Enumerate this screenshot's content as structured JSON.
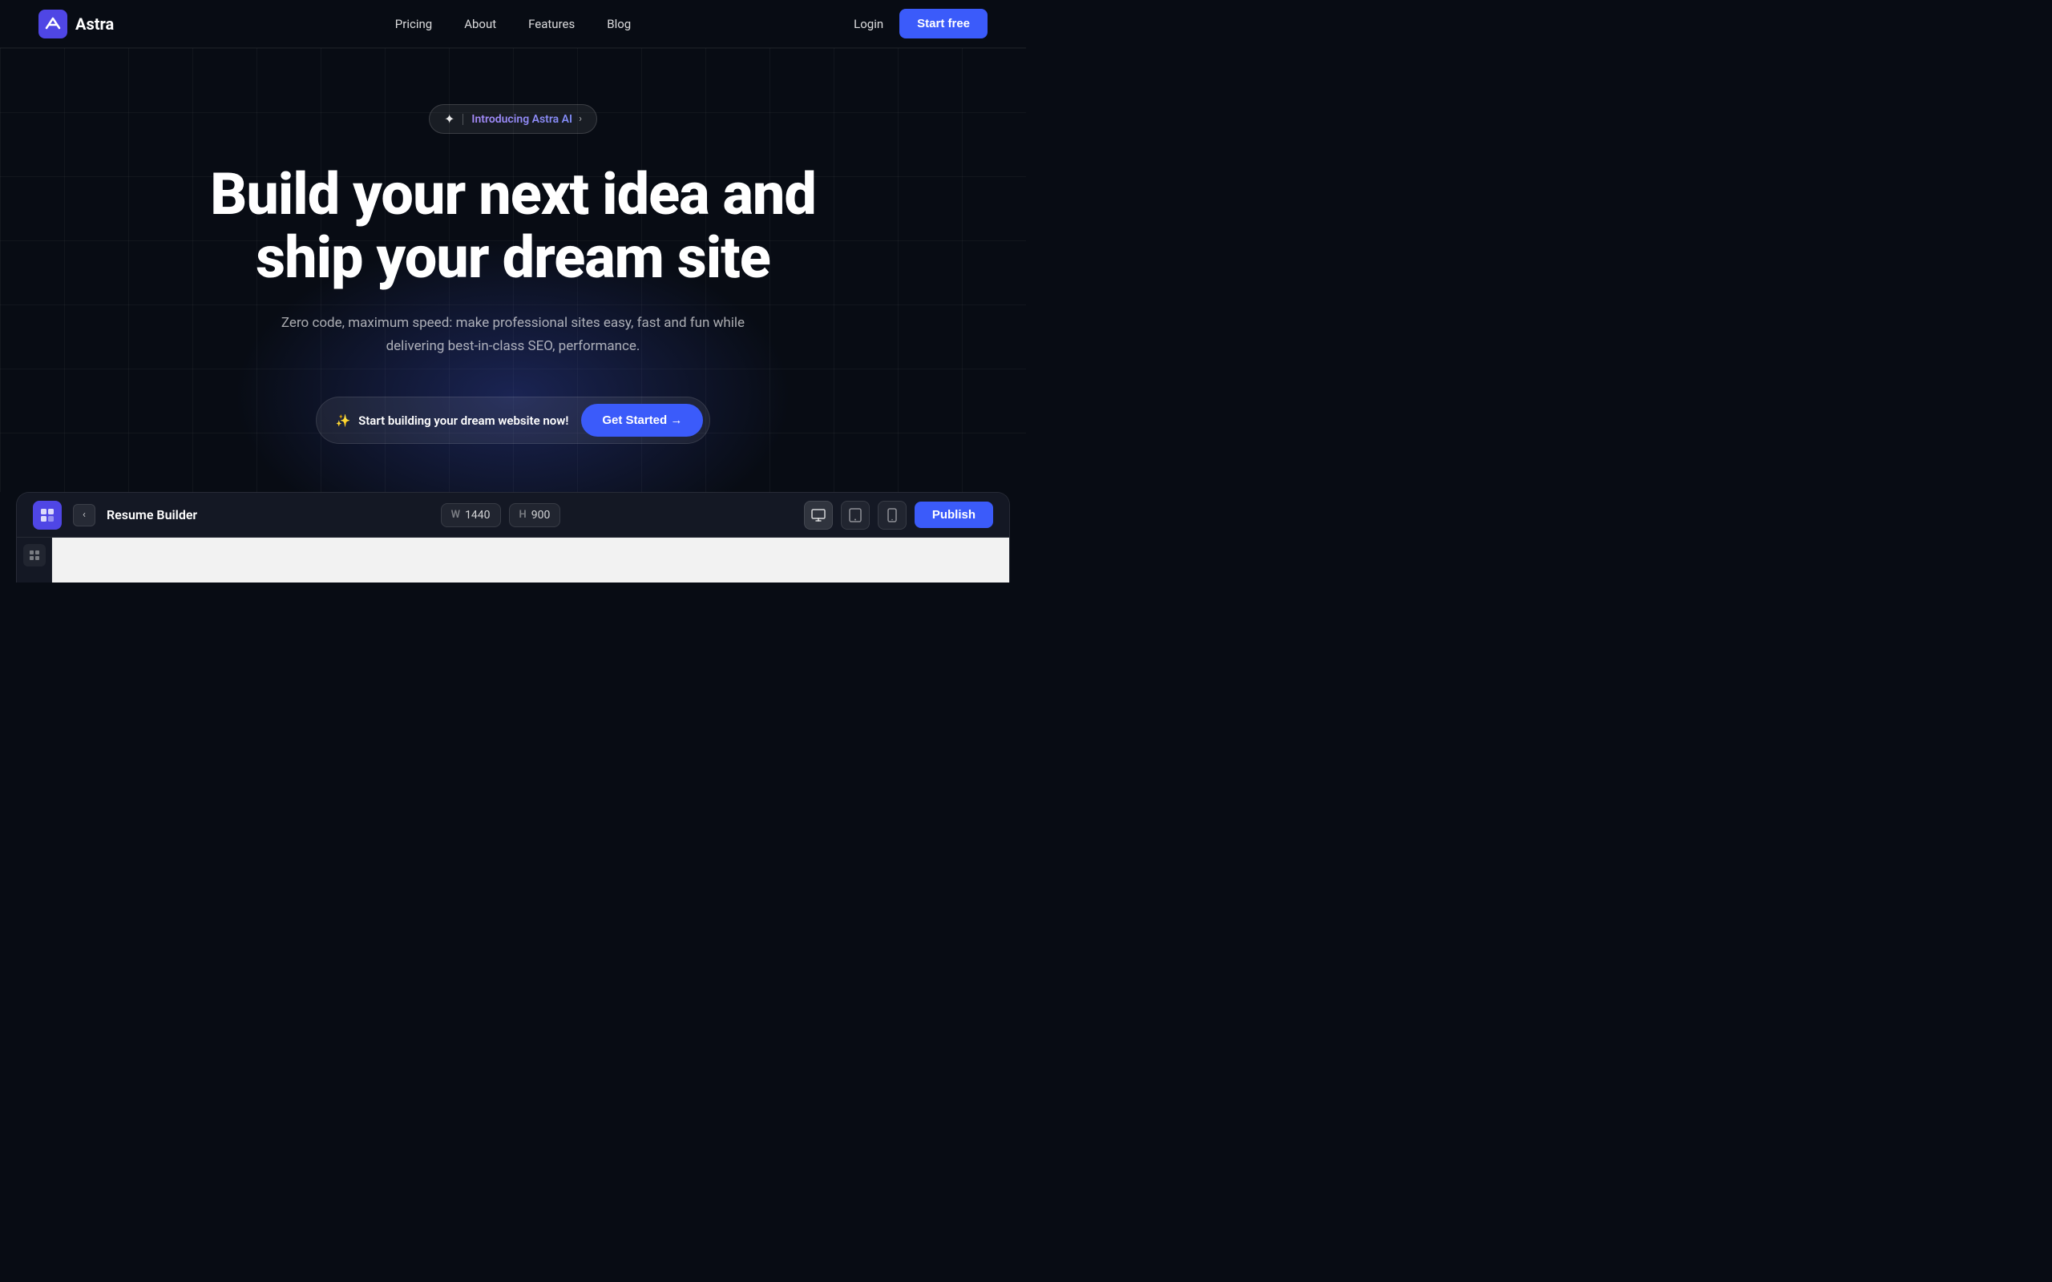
{
  "brand": {
    "name": "Astra",
    "logo_alt": "Astra logo"
  },
  "nav": {
    "links": [
      {
        "label": "Pricing",
        "id": "pricing"
      },
      {
        "label": "About",
        "id": "about"
      },
      {
        "label": "Features",
        "id": "features"
      },
      {
        "label": "Blog",
        "id": "blog"
      }
    ],
    "login_label": "Login",
    "start_free_label": "Start free"
  },
  "hero": {
    "badge_sparkle": "✦",
    "badge_text": "Introducing Astra AI",
    "badge_chevron": "›",
    "title_line1": "Build your next idea and",
    "title_line2": "ship your dream site",
    "subtitle": "Zero code, maximum speed: make professional sites easy, fast and fun while delivering best-in-class SEO, performance.",
    "cta_sparkle": "✨",
    "cta_text": "Start building your dream website now!",
    "cta_button": "Get Started →"
  },
  "builder": {
    "title": "Resume Builder",
    "width_label": "W",
    "width_value": "1440",
    "height_label": "H",
    "height_value": "900",
    "publish_label": "Publish"
  }
}
